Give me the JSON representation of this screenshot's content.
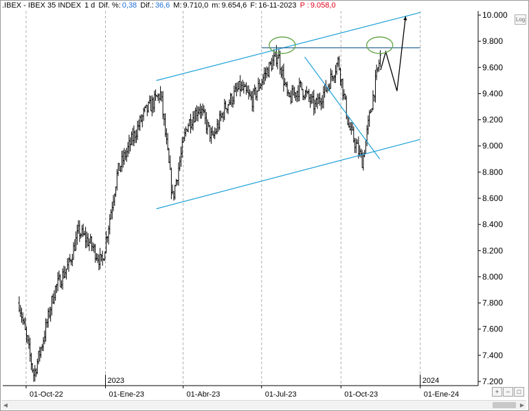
{
  "header": {
    "symbol": ".IBEX - IBEX 35 INDEX",
    "interval": "1 d",
    "dif_pct_label": "Dif. %:",
    "dif_pct_value": "0,38",
    "dif_label": "Dif.:",
    "dif_value": "36,6",
    "max_label": "M:",
    "max_value": "9.710,0",
    "min_label": "m:",
    "min_value": "9.654,6",
    "date_label": "F:",
    "date_value": "16-11-2023",
    "price_label": "P :",
    "price_value": "9.058,0"
  },
  "log_button": "Log",
  "colors": {
    "candle": "#000000",
    "channel": "#1ba0d8",
    "circle": "#6aa84f",
    "grid": "#b0b0b0",
    "header_value": "#1d6fd8",
    "header_price": "#e0001b"
  },
  "chart_data": {
    "type": "line",
    "title": "",
    "xlabel": "",
    "ylabel": "",
    "ylim": [
      7200,
      10000
    ],
    "yticks": [
      "10.000",
      "9.800",
      "9.600",
      "9.400",
      "9.200",
      "9.000",
      "8.800",
      "8.600",
      "8.400",
      "8.200",
      "8.000",
      "7.800",
      "7.600",
      "7.400",
      "7.200"
    ],
    "xticks": [
      "01-Oct-22",
      "01-Ene-23",
      "01-Abr-23",
      "01-Jul-23",
      "01-Oct-23",
      "01-Ene-24"
    ],
    "year_separators": [
      "2023",
      "2024"
    ],
    "series": [
      {
        "x": [
          "23-Sep-22",
          "10-Oct-22",
          "20-Oct-22",
          "03-Nov-22",
          "20-Nov-22",
          "01-Dic-22",
          "15-Dic-22",
          "28-Dic-22",
          "15-Ene-23",
          "01-Feb-23",
          "15-Feb-23",
          "06-Mar-23",
          "20-Mar-23",
          "05-Abr-23",
          "20-Abr-23",
          "05-May-23",
          "20-May-23",
          "06-Jun-23",
          "20-Jun-23",
          "05-Jul-23",
          "20-Jul-23",
          "01-Ago-23",
          "15-Ago-23",
          "01-Sep-23",
          "15-Sep-23",
          "28-Sep-23",
          "10-Oct-23",
          "26-Oct-23",
          "05-Nov-23",
          "16-Nov-23"
        ],
        "y": [
          7800,
          7250,
          7500,
          7900,
          8100,
          8350,
          8250,
          8100,
          8800,
          9050,
          9250,
          9400,
          8600,
          9150,
          9300,
          9050,
          9300,
          9450,
          9350,
          9550,
          9700,
          9350,
          9450,
          9300,
          9450,
          9650,
          9150,
          8880,
          9300,
          9700
        ],
        "approx_points": true
      }
    ],
    "annotations": [
      {
        "label": "upper channel line",
        "from": [
          "01-Mar-23",
          9500
        ],
        "to": [
          "01-Ene-24",
          10020
        ]
      },
      {
        "label": "lower channel line",
        "from": [
          "01-Mar-23",
          8520
        ],
        "to": [
          "01-Ene-24",
          9050
        ]
      },
      {
        "label": "resistance line",
        "from": [
          "01-Jul-23",
          9750
        ],
        "to": [
          "01-Ene-24",
          9750
        ]
      },
      {
        "label": "down trendline",
        "from": [
          "20-Ago-23",
          9680
        ],
        "to": [
          "15-Nov-23",
          8900
        ]
      },
      {
        "label": "projected path",
        "points": [
          [
            "16-Nov-23",
            9580
          ],
          [
            "22-Nov-23",
            9720
          ],
          [
            "05-Dic-23",
            9420
          ],
          [
            "15-Dic-23",
            9990
          ]
        ]
      },
      {
        "label": "top circle 1",
        "at": [
          "25-Jul-23",
          9770
        ]
      },
      {
        "label": "top circle 2",
        "at": [
          "15-Nov-23",
          9770
        ]
      }
    ]
  }
}
